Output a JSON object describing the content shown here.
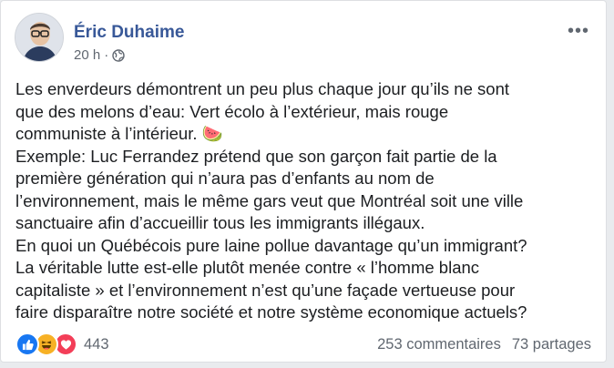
{
  "post": {
    "author": "Éric Duhaime",
    "time": "20 h",
    "separator": "·",
    "body_lines": [
      "Les enverdeurs démontrent un peu plus chaque jour qu’ils ne sont",
      "que des melons d’eau: Vert écolo à l’extérieur, mais rouge",
      "communiste à l’intérieur. 🍉",
      "Exemple: Luc Ferrandez prétend que son garçon fait partie de la",
      "première génération qui n’aura pas d’enfants au nom de",
      "l’environnement, mais le même gars veut que Montréal soit une ville",
      "sanctuaire afin d’accueillir tous les immigrants illégaux.",
      "En quoi un Québécois pure laine pollue davantage qu’un immigrant?",
      "La véritable lutte est-elle plutôt menée contre « l’homme blanc",
      "capitaliste » et l’environnement n’est qu’une façade vertueuse pour",
      "faire disparaître notre société et notre système economique actuels?"
    ]
  },
  "footer": {
    "reaction_count": "443",
    "comments": "253 commentaires",
    "shares": "73 partages"
  },
  "icons": [
    "more-options-icon",
    "globe-icon",
    "like-reaction-icon",
    "haha-reaction-icon",
    "love-reaction-icon"
  ],
  "colors": {
    "author_link": "#385898",
    "like": "#1877f2",
    "haha": "#f7b125",
    "love": "#f33e58"
  }
}
